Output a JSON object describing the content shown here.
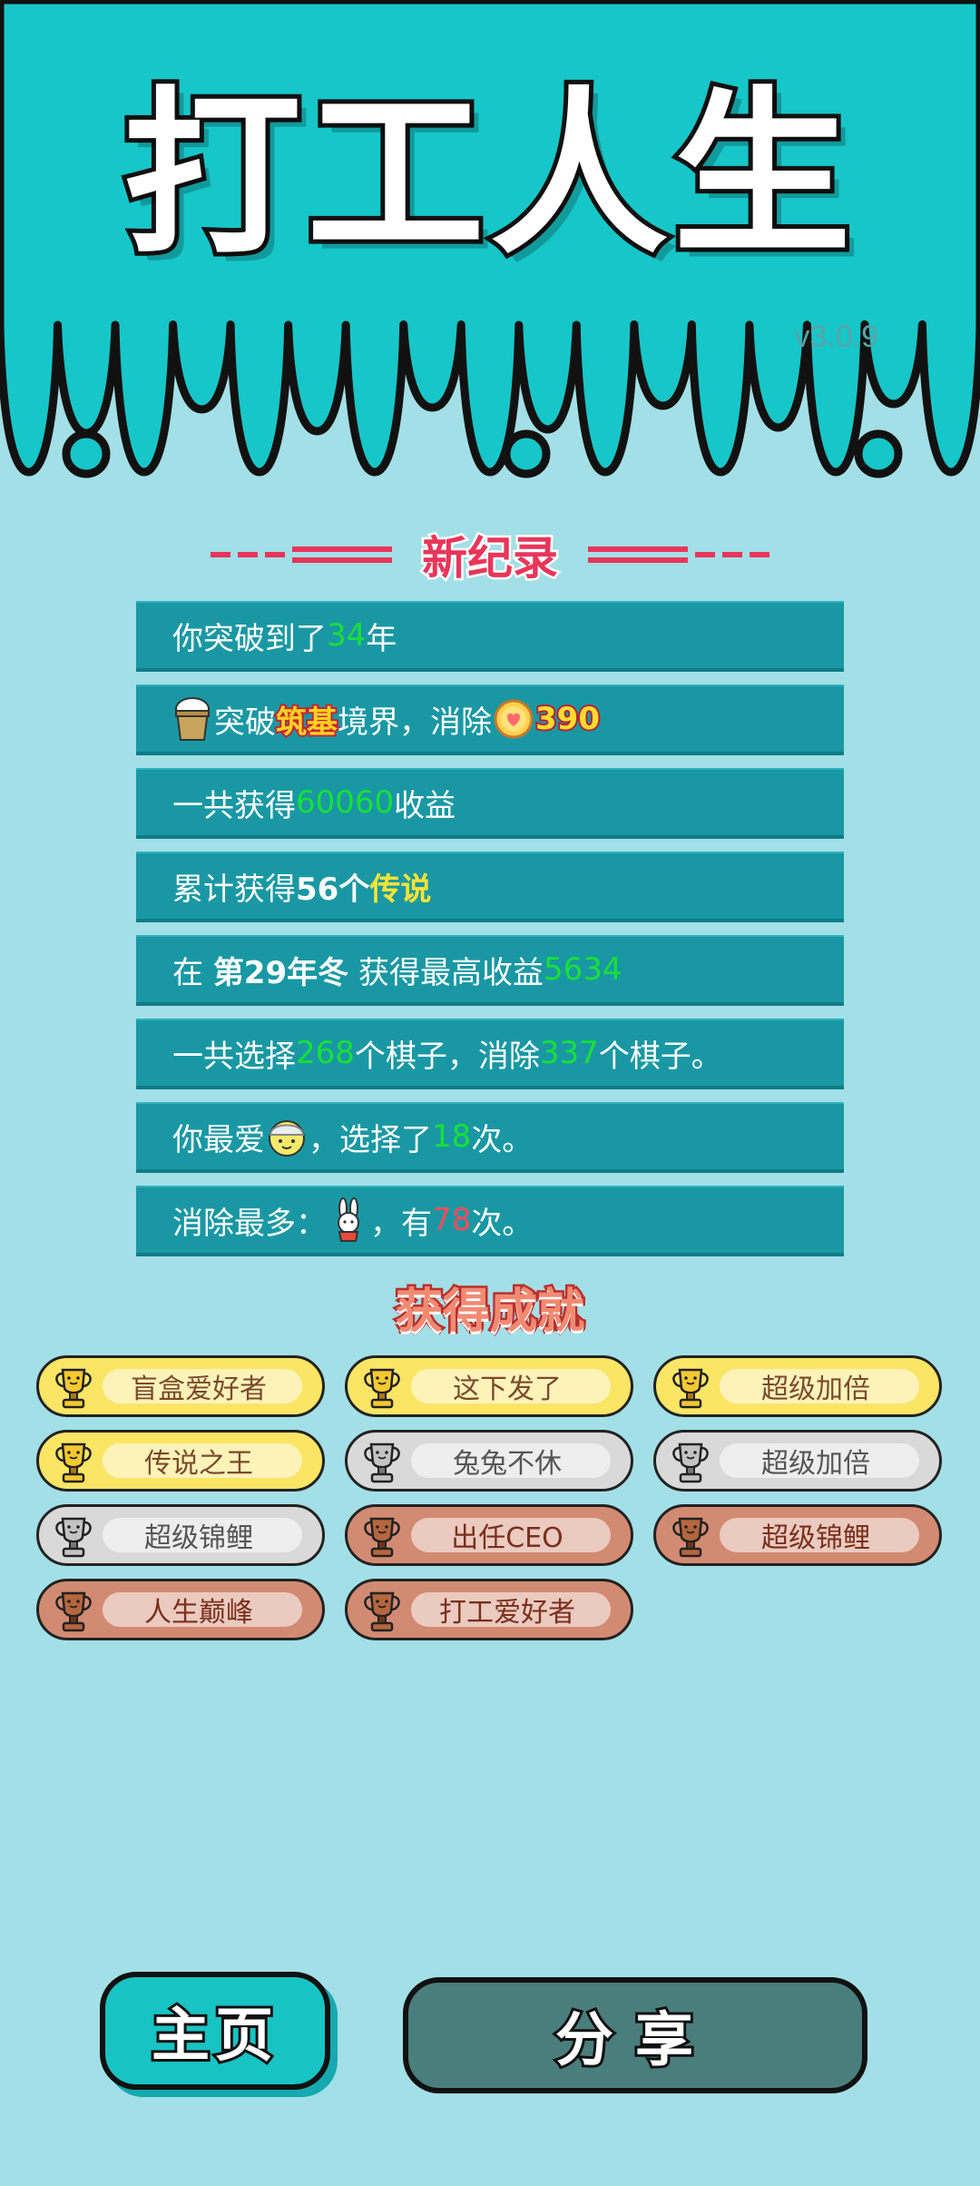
{
  "app": {
    "title": "打工人生",
    "version": "v3.0.9"
  },
  "new_record": {
    "title": "新纪录",
    "rows": [
      {
        "a": "你突破到了",
        "b": "34",
        "c": "年"
      },
      {
        "a": "突破",
        "b": "筑基",
        "c": "境界，消除",
        "d": "390"
      },
      {
        "a": "一共获得",
        "b": "60060",
        "c": "收益"
      },
      {
        "a": "累计获得",
        "b": "56个",
        "c": "传说"
      },
      {
        "a": "在",
        "b": "第29年冬",
        "c": "获得最高收益",
        "d": "5634"
      },
      {
        "a": "一共选择",
        "b": "268",
        "c": "个棋子，消除",
        "d": "337",
        "e": "个棋子。"
      },
      {
        "a": "你最爱",
        "b": "，选择了",
        "c": "18",
        "d": "次。"
      },
      {
        "a": "消除最多：",
        "b": "，有",
        "c": "78",
        "d": "次。"
      }
    ]
  },
  "achievements": {
    "title": "获得成就",
    "items": [
      {
        "label": "盲盒爱好者",
        "tier": "gold"
      },
      {
        "label": "这下发了",
        "tier": "gold"
      },
      {
        "label": "超级加倍",
        "tier": "gold"
      },
      {
        "label": "传说之王",
        "tier": "gold"
      },
      {
        "label": "兔兔不休",
        "tier": "silver"
      },
      {
        "label": "超级加倍",
        "tier": "silver"
      },
      {
        "label": "超级锦鲤",
        "tier": "silver"
      },
      {
        "label": "出任CEO",
        "tier": "bronze"
      },
      {
        "label": "超级锦鲤",
        "tier": "bronze"
      },
      {
        "label": "人生巅峰",
        "tier": "bronze"
      },
      {
        "label": "打工爱好者",
        "tier": "bronze"
      }
    ]
  },
  "buttons": {
    "home": "主页",
    "share": "分享"
  },
  "icons": {
    "realm": "bucket-icon",
    "coin": "heart-coin-icon",
    "favorite": "chef-face-icon",
    "most_removed": "rabbit-icon",
    "trophy": "trophy-icon"
  },
  "colors": {
    "header": "#17c6c8",
    "row": "#1998a4",
    "highlight_green": "#18e038",
    "highlight_yellow": "#ffe433",
    "highlight_red": "#ff4b5a"
  }
}
